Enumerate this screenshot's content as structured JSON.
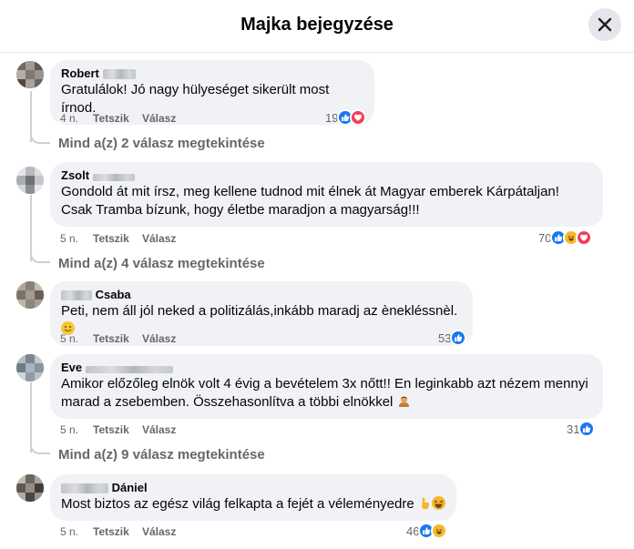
{
  "header": {
    "title": "Majka bejegyzése"
  },
  "comments": [
    {
      "author": "Robert",
      "text": "Gratulálok! Jó nagy hülyeséget sikerült most írnod.",
      "time": "4 n.",
      "like_label": "Tetszik",
      "reply_label": "Válasz",
      "reaction_count": "19",
      "reactions": [
        "like-icon",
        "love-icon"
      ],
      "replies_link": "Mind a(z) 2 válasz megtekintése"
    },
    {
      "author": "Zsolt",
      "text": "Gondold át mit írsz, meg kellene tudnod mit élnek át Magyar emberek Kárpátaljan! Csak Tramba bízunk, hogy életbe maradjon a magyarság!!!",
      "time": "5 n.",
      "like_label": "Tetszik",
      "reply_label": "Válasz",
      "reaction_count": "70",
      "reactions": [
        "like-icon",
        "haha-icon",
        "love-icon"
      ],
      "replies_link": "Mind a(z) 4 válasz megtekintése"
    },
    {
      "author": "Csaba",
      "text": "Peti, nem áll jól neked a politizálás,inkább maradj az ènekléssnèl.",
      "time": "5 n.",
      "like_label": "Tetszik",
      "reply_label": "Válasz",
      "reaction_count": "53",
      "reactions": [
        "like-icon"
      ]
    },
    {
      "author": "Eve",
      "text": "Amikor előzőleg elnök volt 4 évig a bevételem 3x nőtt!! En leginkabb azt nézem mennyi marad a zsebemben. Összehasonlítva a többi elnökkel",
      "time": "5 n.",
      "like_label": "Tetszik",
      "reply_label": "Válasz",
      "reaction_count": "31",
      "reactions": [
        "like-icon"
      ],
      "replies_link": "Mind a(z) 9 válasz megtekintése"
    },
    {
      "author": "Dániel",
      "text": "Most biztos az egész világ felkapta a fejét a véleményedre",
      "time": "5 n.",
      "like_label": "Tetszik",
      "reply_label": "Válasz",
      "reaction_count": "46",
      "reactions": [
        "like-icon",
        "haha-icon"
      ]
    }
  ],
  "colors": {
    "like": "#1877f2",
    "love": "#f33e58",
    "haha": "#f7b928",
    "bubble": "#f0f2f5",
    "secondary_text": "#65676b"
  }
}
